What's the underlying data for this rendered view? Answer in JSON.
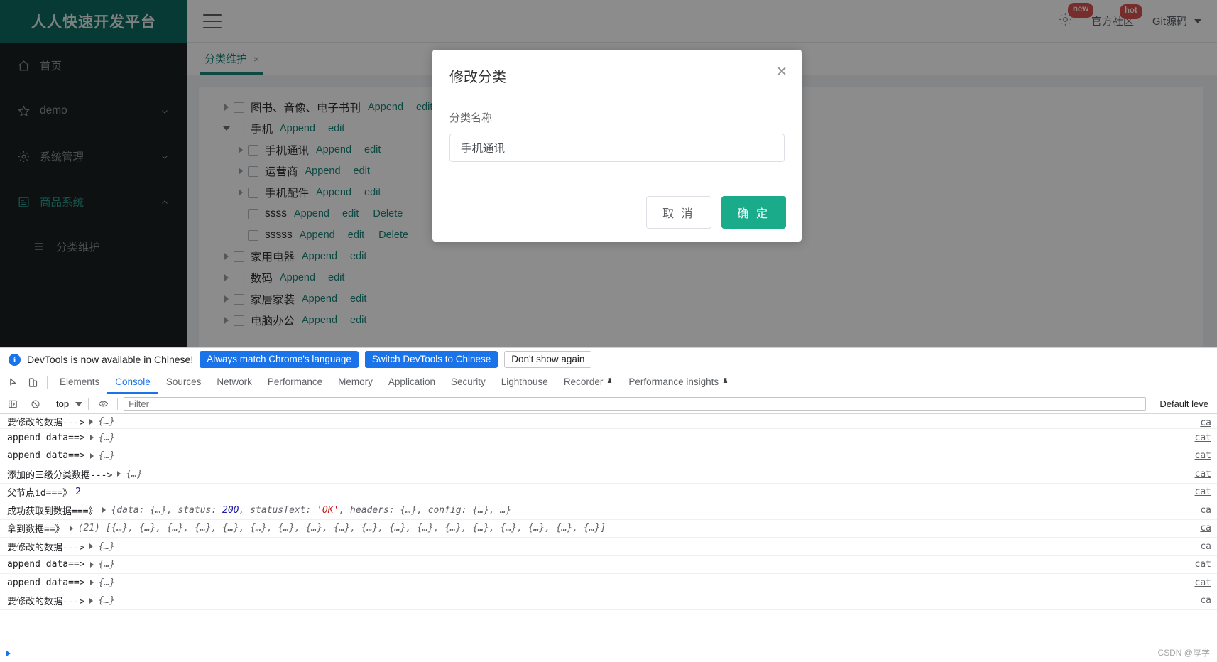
{
  "app": {
    "logo_text": "人人快速开发平台"
  },
  "sidebar": {
    "items": [
      {
        "label": "首页",
        "icon": "home-icon",
        "has_arrow": false,
        "active": false
      },
      {
        "label": "demo",
        "icon": "star-icon",
        "has_arrow": true,
        "active": false
      },
      {
        "label": "系统管理",
        "icon": "gear-icon",
        "has_arrow": true,
        "active": false
      },
      {
        "label": "商品系统",
        "icon": "document-icon",
        "has_arrow": true,
        "active": true
      }
    ],
    "sub_items": [
      {
        "label": "分类维护",
        "icon": "list-icon"
      }
    ]
  },
  "topbar": {
    "menu_icon": "hamburger-icon",
    "settings_icon": "gear-icon",
    "settings_badge": "new",
    "community_label": "官方社区",
    "community_badge": "hot",
    "git_label": "Git源码",
    "git_caret": "chevron-down-icon"
  },
  "tabs": [
    {
      "label": "分类维护",
      "close": "×",
      "active": true
    }
  ],
  "tree": {
    "append_label": "Append",
    "edit_label": "edit",
    "delete_label": "Delete",
    "rows": [
      {
        "level": 1,
        "arrow": "collapsed",
        "label": "图书、音像、电子书刊",
        "actions": [
          "Append",
          "edit"
        ]
      },
      {
        "level": 1,
        "arrow": "expanded",
        "label": "手机",
        "actions": [
          "Append",
          "edit"
        ]
      },
      {
        "level": 2,
        "arrow": "collapsed",
        "label": "手机通讯",
        "actions": [
          "Append",
          "edit"
        ]
      },
      {
        "level": 2,
        "arrow": "collapsed",
        "label": "运营商",
        "actions": [
          "Append",
          "edit"
        ]
      },
      {
        "level": 2,
        "arrow": "collapsed",
        "label": "手机配件",
        "actions": [
          "Append",
          "edit"
        ]
      },
      {
        "level": 2,
        "arrow": "none",
        "label": "ssss",
        "actions": [
          "Append",
          "edit",
          "Delete"
        ]
      },
      {
        "level": 2,
        "arrow": "none",
        "label": "sssss",
        "actions": [
          "Append",
          "edit",
          "Delete"
        ]
      },
      {
        "level": 1,
        "arrow": "collapsed",
        "label": "家用电器",
        "actions": [
          "Append",
          "edit"
        ]
      },
      {
        "level": 1,
        "arrow": "collapsed",
        "label": "数码",
        "actions": [
          "Append",
          "edit"
        ]
      },
      {
        "level": 1,
        "arrow": "collapsed",
        "label": "家居家装",
        "actions": [
          "Append",
          "edit"
        ]
      },
      {
        "level": 1,
        "arrow": "collapsed",
        "label": "电脑办公",
        "actions": [
          "Append",
          "edit"
        ]
      }
    ]
  },
  "dialog": {
    "title": "修改分类",
    "close_icon": "close-icon",
    "field_label": "分类名称",
    "input_value": "手机通讯",
    "input_placeholder": "",
    "cancel_label": "取 消",
    "confirm_label": "确 定",
    "confirm_color": "#1aab8b"
  },
  "devtools": {
    "notice": {
      "icon": "info-icon",
      "text": "DevTools is now available in Chinese!",
      "buttons": [
        {
          "label": "Always match Chrome's language",
          "style": "primary"
        },
        {
          "label": "Switch DevTools to Chinese",
          "style": "primary"
        },
        {
          "label": "Don't show again",
          "style": "ghost"
        }
      ]
    },
    "tools": [
      {
        "icon": "inspect-icon"
      },
      {
        "icon": "device-toolbar-icon"
      }
    ],
    "tabs": [
      {
        "label": "Elements",
        "selected": false,
        "warn": false
      },
      {
        "label": "Console",
        "selected": true,
        "warn": false
      },
      {
        "label": "Sources",
        "selected": false,
        "warn": false
      },
      {
        "label": "Network",
        "selected": false,
        "warn": false
      },
      {
        "label": "Performance",
        "selected": false,
        "warn": false
      },
      {
        "label": "Memory",
        "selected": false,
        "warn": false
      },
      {
        "label": "Application",
        "selected": false,
        "warn": false
      },
      {
        "label": "Security",
        "selected": false,
        "warn": false
      },
      {
        "label": "Lighthouse",
        "selected": false,
        "warn": false
      },
      {
        "label": "Recorder",
        "selected": false,
        "warn": true
      },
      {
        "label": "Performance insights",
        "selected": false,
        "warn": true
      }
    ],
    "filterbar": {
      "execute_icon": "sidebar-toggle-icon",
      "clear_icon": "clear-console-icon",
      "context": "top",
      "context_caret": "chevron-down-icon",
      "eye_icon": "eye-icon",
      "filter_placeholder": "Filter",
      "filter_value": "",
      "level": "Default leve",
      "level_caret": "chevron-down-icon"
    },
    "logs": [
      {
        "text": "要修改的数据--->",
        "disc": true,
        "obj": "{…}",
        "source": "ca",
        "clipped": true
      },
      {
        "text": "append data==>",
        "disc": true,
        "obj": "{…}",
        "source": "cat"
      },
      {
        "text": "append data==>",
        "disc": true,
        "obj": "{…}",
        "source": "cat"
      },
      {
        "text": "添加的三级分类数据--->",
        "disc": true,
        "obj": "{…}",
        "source": "cat"
      },
      {
        "text": "父节点id===》",
        "disc": false,
        "num": "2",
        "source": "cat"
      },
      {
        "text": "成功获取到数据===》",
        "disc": true,
        "rich": "success",
        "source": "ca"
      },
      {
        "text": "拿到数据==》",
        "disc": true,
        "rich": "array21",
        "source": "ca"
      },
      {
        "text": "要修改的数据--->",
        "disc": true,
        "obj": "{…}",
        "source": "ca"
      },
      {
        "text": "append data==>",
        "disc": true,
        "obj": "{…}",
        "source": "cat"
      },
      {
        "text": "append data==>",
        "disc": true,
        "obj": "{…}",
        "source": "cat"
      },
      {
        "text": "要修改的数据--->",
        "disc": true,
        "obj": "{…}",
        "source": "ca"
      }
    ],
    "rich": {
      "success": {
        "prefix": "{data: {…}, status: ",
        "status": "200",
        "mid": ", statusText: ",
        "statusText": "'OK'",
        "suffix": ", headers: {…}, config: {…}, …}"
      },
      "array21": {
        "count": "(21)",
        "body": "[{…}, {…}, {…}, {…}, {…}, {…}, {…}, {…}, {…}, {…}, {…}, {…}, {…}, {…}, {…}, {…}, {…}, {…}]"
      }
    },
    "watermark": "CSDN @厚学"
  }
}
